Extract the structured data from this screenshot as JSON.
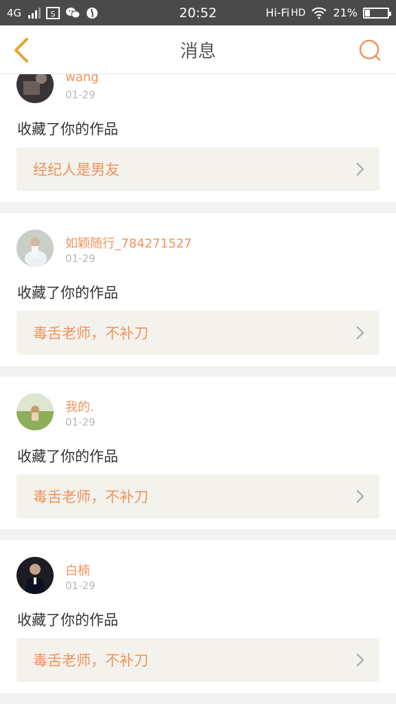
{
  "status_bar": {
    "network": "4G",
    "time": "20:52",
    "hifi": "Hi-Fi",
    "hd": "HD",
    "battery": "21%"
  },
  "header": {
    "title": "消息",
    "back_icon": "chevron-left-icon",
    "search_icon": "search-icon"
  },
  "messages": [
    {
      "name": "wang",
      "date": "01-29",
      "action": "收藏了你的作品",
      "work": "经纪人是男友"
    },
    {
      "name": "如颖随行_784271527",
      "date": "01-29",
      "action": "收藏了你的作品",
      "work": "毒舌老师，不补刀"
    },
    {
      "name": "我的.",
      "date": "01-29",
      "action": "收藏了你的作品",
      "work": "毒舌老师，不补刀"
    },
    {
      "name": "白楠",
      "date": "01-29",
      "action": "收藏了你的作品",
      "work": "毒舌老师，不补刀"
    }
  ],
  "colors": {
    "accent": "#f0935c",
    "back_arrow": "#e8a32e",
    "status_bar": "#4a4a4a",
    "work_box": "#f3f2ec"
  }
}
